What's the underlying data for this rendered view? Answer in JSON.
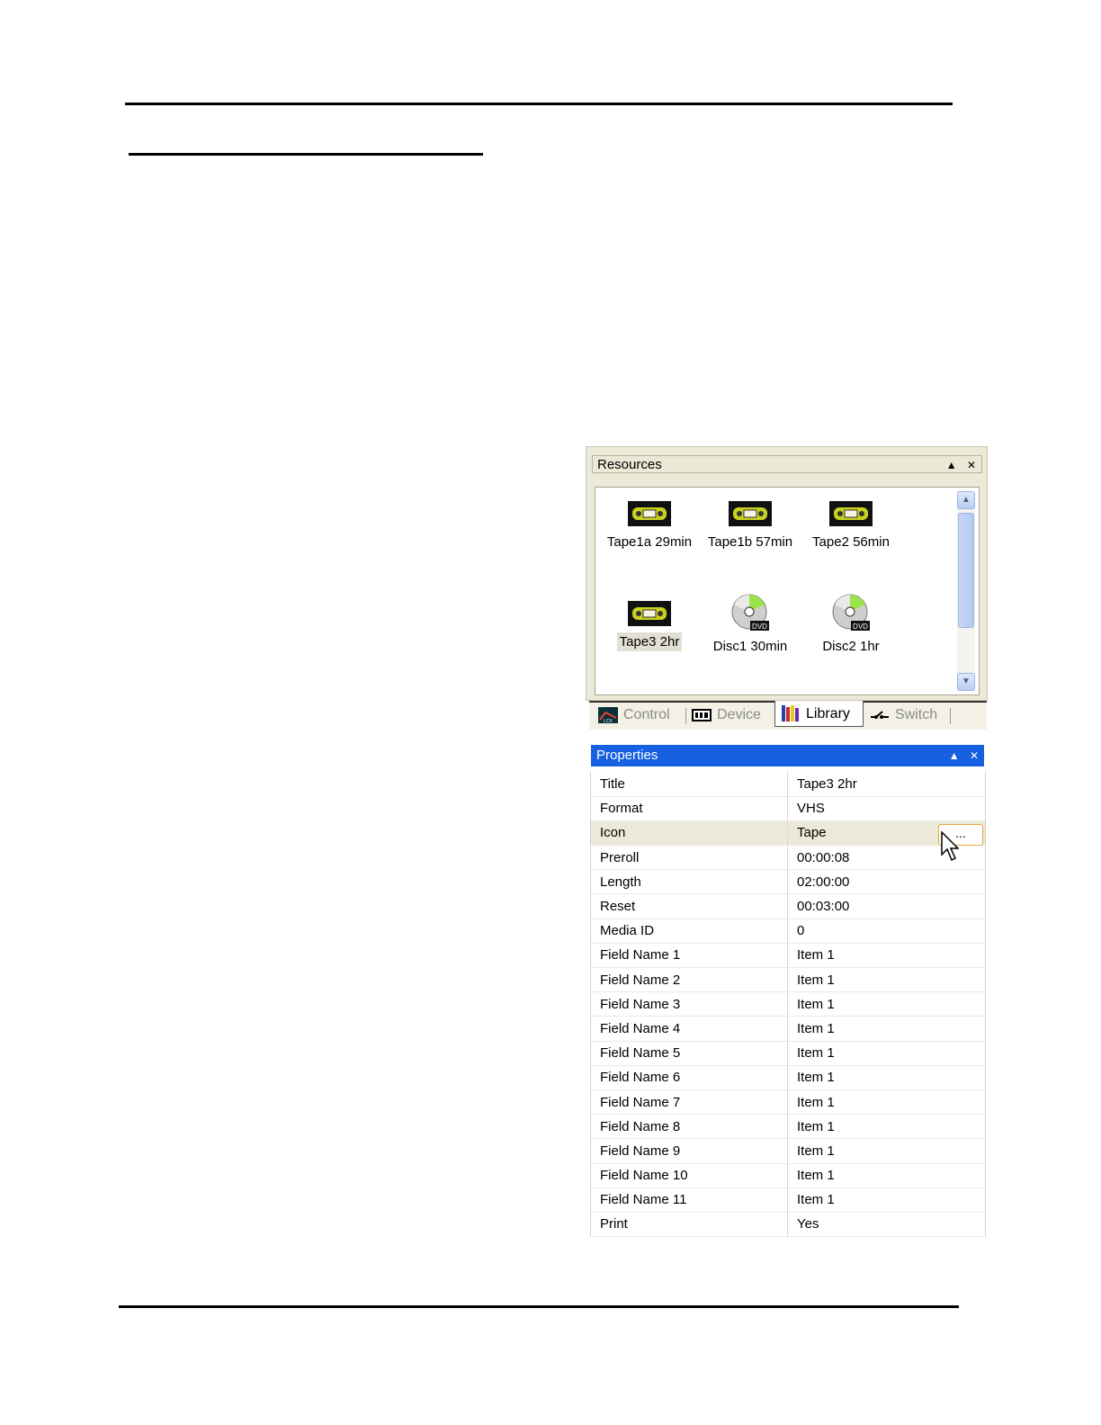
{
  "resources": {
    "title": "Resources",
    "items": [
      {
        "label": "Tape1a 29min",
        "icon": "vhs-tape-icon"
      },
      {
        "label": "Tape1b 57min",
        "icon": "vhs-tape-icon"
      },
      {
        "label": "Tape2 56min",
        "icon": "vhs-tape-icon"
      },
      {
        "label": "Tape3 2hr",
        "icon": "vhs-tape-icon",
        "selected": true
      },
      {
        "label": "Disc1 30min",
        "icon": "dvd-disc-icon"
      },
      {
        "label": "Disc2 1hr",
        "icon": "dvd-disc-icon"
      }
    ]
  },
  "tabs": [
    {
      "label": "Control",
      "icon": "control-icon"
    },
    {
      "label": "Device",
      "icon": "device-icon"
    },
    {
      "label": "Library",
      "icon": "library-icon",
      "active": true
    },
    {
      "label": "Switch",
      "icon": "switch-icon"
    }
  ],
  "properties": {
    "title": "Properties",
    "rows": [
      {
        "name": "Title",
        "value": "Tape3 2hr"
      },
      {
        "name": "Format",
        "value": "VHS"
      },
      {
        "name": "Icon",
        "value": "Tape"
      },
      {
        "name": "Preroll",
        "value": "00:00:08"
      },
      {
        "name": "Length",
        "value": "02:00:00"
      },
      {
        "name": "Reset",
        "value": "00:03:00"
      },
      {
        "name": "Media ID",
        "value": "0"
      },
      {
        "name": "Field Name 1",
        "value": "Item 1"
      },
      {
        "name": "Field Name 2",
        "value": "Item 1"
      },
      {
        "name": "Field Name 3",
        "value": "Item 1"
      },
      {
        "name": "Field Name 4",
        "value": "Item 1"
      },
      {
        "name": "Field Name 5",
        "value": "Item 1"
      },
      {
        "name": "Field Name 6",
        "value": "Item 1"
      },
      {
        "name": "Field Name 7",
        "value": "Item 1"
      },
      {
        "name": "Field Name 8",
        "value": "Item 1"
      },
      {
        "name": "Field Name 9",
        "value": "Item 1"
      },
      {
        "name": "Field Name 10",
        "value": "Item 1"
      },
      {
        "name": "Field Name 11",
        "value": "Item 1"
      },
      {
        "name": "Print",
        "value": "Yes"
      }
    ],
    "ellipsis_label": "..."
  },
  "header_buttons": {
    "collapse": "▲",
    "close": "✕"
  },
  "colors": {
    "properties_header": "#1660e1",
    "panel_bg": "#ece9d8"
  }
}
